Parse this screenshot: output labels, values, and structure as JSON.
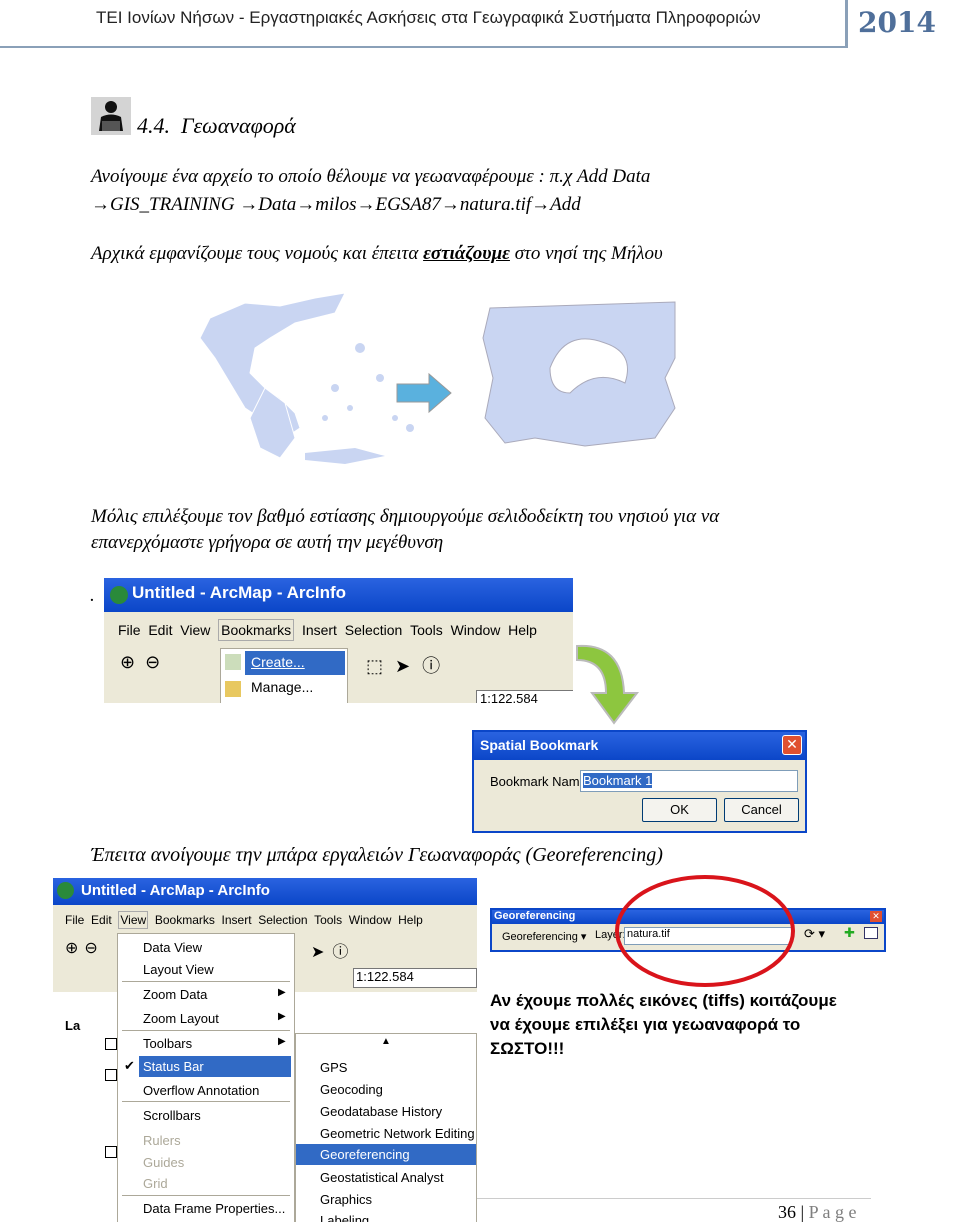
{
  "header": {
    "title": "ΤΕΙ Ιονίων Νήσων - Εργαστηριακές Ασκήσεις στα Γεωγραφικά Συστήματα Πληροφοριών",
    "year": "2014"
  },
  "section": {
    "number": "4.4.",
    "title": "Γεωαναφορά",
    "icon": "person-at-computer-icon"
  },
  "paragraphs": {
    "p1_line1": "Ανοίγουμε ένα αρχείο το οποίο θέλουμε να γεωαναφέρουμε : π.χ Add Data",
    "p1_line2": "→GIS_TRAINING →Data→milos→EGSA87→natura.tif→Add",
    "p2_pre": "Αρχικά εμφανίζουμε τους νομούς και έπειτα ",
    "p2_em": "εστιάζουμε",
    "p2_post": " στο νησί της Μήλου",
    "p3_line1": "Μόλις επιλέξουμε τον βαθμό εστίασης δημιουργούμε σελιδοδείκτη του νησιού για να",
    "p3_line2": "επανερχόμαστε γρήγορα σε αυτή την μεγέθυνση",
    "dot": ".",
    "p4": "Έπειτα ανοίγουμε την μπάρα εργαλειών Γεωαναφοράς (Georeferencing)",
    "note_line1": "Αν έχουμε πολλές εικόνες (tiffs) κοιτάζουμε",
    "note_line2": "να έχουμε επιλέξει για γεωαναφορά το",
    "note_line3": "ΣΩΣΤΟ!!!"
  },
  "colors": {
    "map_fill": "#c9d5f2",
    "accent": "#4f6f9a",
    "highlight": "#316ac5",
    "circle": "#d9141b"
  },
  "arcmap1": {
    "title": "Untitled - ArcMap - ArcInfo",
    "menu": [
      "File",
      "Edit",
      "View",
      "Bookmarks",
      "Insert",
      "Selection",
      "Tools",
      "Window",
      "Help"
    ],
    "bookmarks_menu": [
      "Create...",
      "Manage..."
    ],
    "scale": "1:122.584"
  },
  "dialog": {
    "title": "Spatial Bookmark",
    "label": "Bookmark Name:",
    "value": "Bookmark 1",
    "ok": "OK",
    "cancel": "Cancel"
  },
  "arcmap2": {
    "title": "Untitled - ArcMap - ArcInfo",
    "menu": [
      "File",
      "Edit",
      "View",
      "Bookmarks",
      "Insert",
      "Selection",
      "Tools",
      "Window",
      "Help"
    ],
    "scale": "1:122.584",
    "toc_label": "La",
    "view_menu": [
      "Data View",
      "Layout View",
      "Zoom Data",
      "Zoom Layout",
      "Toolbars",
      "Status Bar",
      "Overflow Annotation",
      "Scrollbars",
      "Rulers",
      "Guides",
      "Grid",
      "Data Frame Properties..."
    ],
    "toolbars_menu": [
      "GPS",
      "Geocoding",
      "Geodatabase History",
      "Geometric Network Editing",
      "Georeferencing",
      "Geostatistical Analyst",
      "Graphics",
      "Labeling"
    ]
  },
  "geo_toolbar": {
    "title": "Georeferencing",
    "menu": "Georeferencing",
    "layer_label": "Layer:",
    "layer_value": "natura.tif"
  },
  "footer": {
    "page": "36",
    "sep": " | ",
    "label": "P a g e"
  }
}
